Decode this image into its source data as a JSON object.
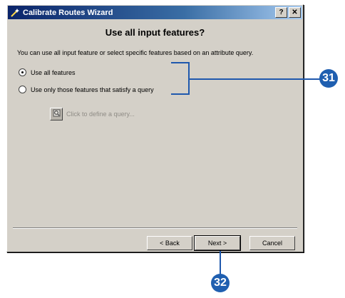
{
  "window": {
    "title": "Calibrate Routes Wizard",
    "help_label": "?",
    "close_label": "✕"
  },
  "heading": "Use all input features?",
  "description": "You can use all input feature or select specific features based on an attribute query.",
  "options": {
    "all_label": "Use all features",
    "query_label": "Use only those features that satisfy a query",
    "selected": "all"
  },
  "query": {
    "label": "Click to define a query..."
  },
  "buttons": {
    "back": "< Back",
    "next": "Next >",
    "cancel": "Cancel"
  },
  "callouts": {
    "first": "31",
    "second": "32"
  },
  "colors": {
    "callout": "#1f5fb0",
    "titlebar": "#0a246a"
  }
}
